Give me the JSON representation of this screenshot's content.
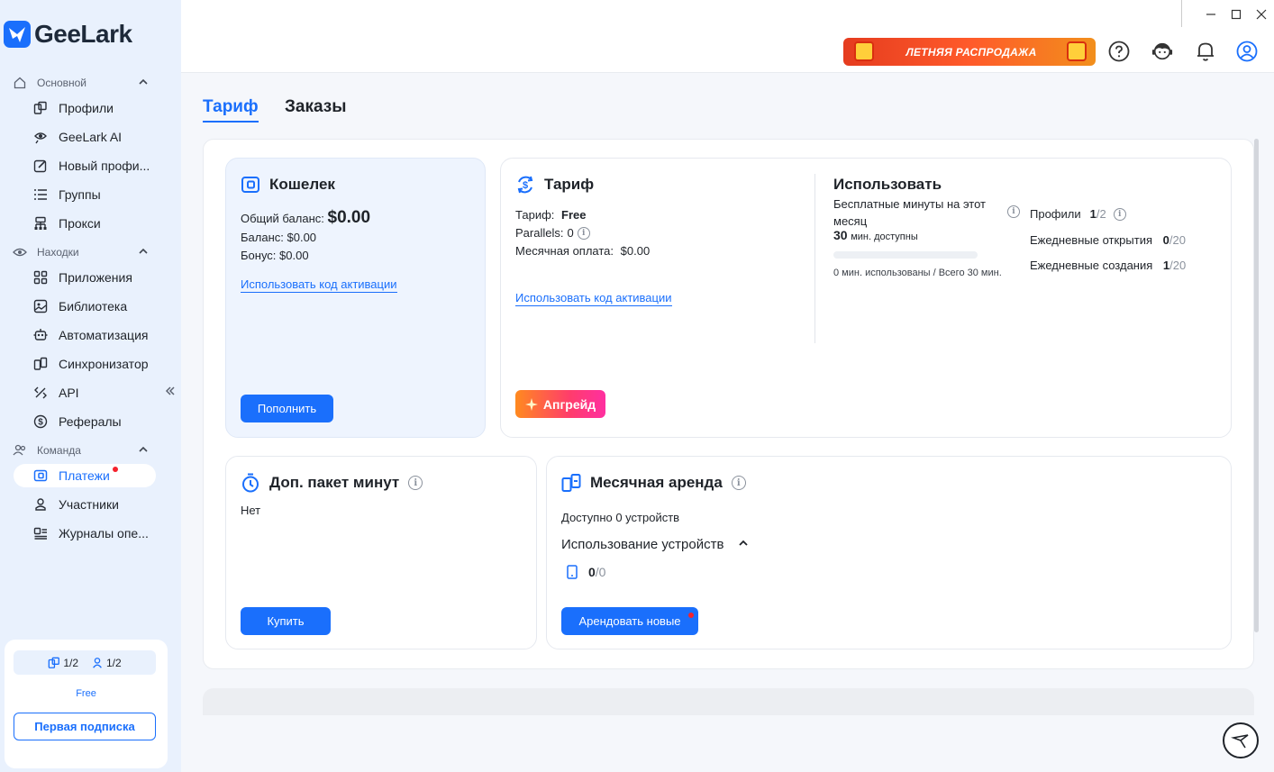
{
  "app": {
    "name": "GeeLark"
  },
  "window_controls": {
    "minimize": "—",
    "maximize": "☐",
    "close": "✕"
  },
  "sidebar": {
    "sections": [
      {
        "label": "Основной",
        "icon": "home-icon"
      },
      {
        "label": "Находки",
        "icon": "eye-icon"
      },
      {
        "label": "Команда",
        "icon": "team-icon"
      }
    ],
    "items": [
      {
        "label": "Профили",
        "icon": "profiles-icon"
      },
      {
        "label": "GeeLark AI",
        "icon": "ai-icon"
      },
      {
        "label": "Новый профи...",
        "icon": "edit-icon"
      },
      {
        "label": "Группы",
        "icon": "list-icon"
      },
      {
        "label": "Прокси",
        "icon": "proxy-icon"
      },
      {
        "label": "Приложения",
        "icon": "apps-icon"
      },
      {
        "label": "Библиотека",
        "icon": "library-icon"
      },
      {
        "label": "Автоматизация",
        "icon": "robot-icon"
      },
      {
        "label": "Синхронизатор",
        "icon": "sync-icon"
      },
      {
        "label": "API",
        "icon": "api-icon"
      },
      {
        "label": "Рефералы",
        "icon": "dollar-icon"
      },
      {
        "label": "Платежи",
        "icon": "wallet-icon"
      },
      {
        "label": "Участники",
        "icon": "user-icon"
      },
      {
        "label": "Журналы опе...",
        "icon": "log-icon"
      }
    ],
    "plan": {
      "profiles_count": "1/2",
      "members_count": "1/2",
      "plan_name": "Free",
      "first_subscription_label": "Первая подписка"
    }
  },
  "topbar": {
    "promo_label": "ЛЕТНЯЯ РАСПРОДАЖА"
  },
  "tabs": [
    {
      "label": "Тариф",
      "active": true
    },
    {
      "label": "Заказы",
      "active": false
    }
  ],
  "wallet": {
    "title": "Кошелек",
    "total_balance_label": "Общий баланс:",
    "total_balance_value": "$0.00",
    "balance_label": "Баланс:",
    "balance_value": "$0.00",
    "bonus_label": "Бонус:",
    "bonus_value": "$0.00",
    "activation_link": "Использовать код активации",
    "topup_button": "Пополнить"
  },
  "tariff": {
    "title": "Тариф",
    "plan_label": "Тариф:",
    "plan_value": "Free",
    "parallels_label": "Parallels:",
    "parallels_value": "0",
    "monthly_label": "Месячная оплата:",
    "monthly_value": "$0.00",
    "activation_link": "Использовать код активации",
    "upgrade_button": "Апгрейд"
  },
  "usage": {
    "title": "Использовать",
    "free_minutes_label_line1": "Бесплатные минуты на этот",
    "free_minutes_label_line2": "месяц",
    "minutes_available_value": "30",
    "minutes_available_suffix": "мин. доступны",
    "minutes_used_fraction": 0,
    "minutes_used_text": "0 мин. использованы / Всего 30 мин.",
    "profiles_label": "Профили",
    "profiles_used": "1",
    "profiles_total": "/2",
    "daily_opens_label": "Ежедневные открытия",
    "daily_opens_used": "0",
    "daily_opens_total": "/20",
    "daily_creates_label": "Ежедневные создания",
    "daily_creates_used": "1",
    "daily_creates_total": "/20"
  },
  "minutes_pack": {
    "title": "Доп. пакет минут",
    "value": "Нет",
    "buy_button": "Купить"
  },
  "monthly_rent": {
    "title": "Месячная аренда",
    "available_text": "Доступно 0 устройств",
    "devices_usage_label": "Использование устройств",
    "devices_used": "0",
    "devices_total": "/0",
    "rent_button": "Арендовать новые"
  },
  "colors": {
    "accent": "#1a6ffc",
    "sidebar_bg": "#e9f1fd",
    "alert_dot": "#f5222d"
  }
}
